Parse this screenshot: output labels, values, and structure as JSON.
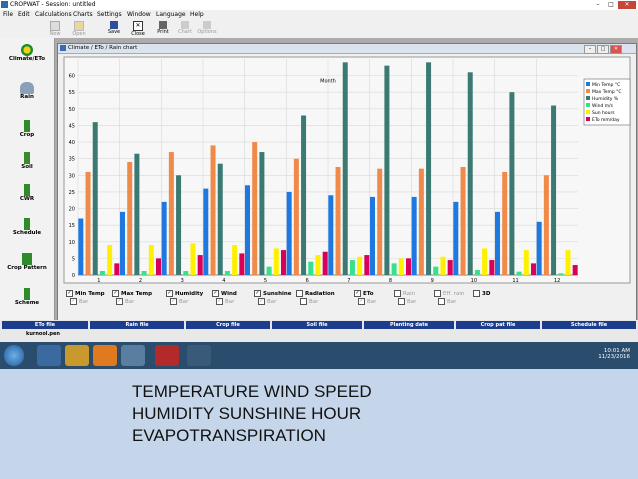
{
  "app": {
    "title": "CROPWAT - Session: untitled"
  },
  "menu": [
    "File",
    "Edit",
    "Calculations",
    "Charts",
    "Settings",
    "Window",
    "Language",
    "Help"
  ],
  "toolbar": [
    {
      "label": "New",
      "enabled": false,
      "icon": "new-file-icon"
    },
    {
      "label": "Open",
      "enabled": false,
      "icon": "open-folder-icon"
    },
    {
      "label": "Save",
      "enabled": true,
      "icon": "save-disk-icon"
    },
    {
      "label": "Close",
      "enabled": true,
      "icon": "close-icon"
    },
    {
      "label": "Print",
      "enabled": true,
      "icon": "print-icon"
    },
    {
      "label": "Chart",
      "enabled": false,
      "icon": "chart-icon"
    },
    {
      "label": "Options",
      "enabled": false,
      "icon": "options-icon"
    }
  ],
  "sidebar": [
    {
      "label": "Climate/ETo",
      "icon": "climate-icon"
    },
    {
      "label": "Rain",
      "icon": "rain-icon"
    },
    {
      "label": "Crop",
      "icon": "crop-icon"
    },
    {
      "label": "Soil",
      "icon": "soil-icon"
    },
    {
      "label": "CWR",
      "icon": "cwr-icon"
    },
    {
      "label": "Schedule",
      "icon": "schedule-icon"
    },
    {
      "label": "Crop Pattern",
      "icon": "crop-pattern-icon"
    },
    {
      "label": "Scheme",
      "icon": "scheme-icon"
    }
  ],
  "window": {
    "title": "Climate / ETo / Rain chart"
  },
  "chart_data": {
    "type": "bar",
    "title": "",
    "xlabel": "Month",
    "ylabel": "",
    "ylim": [
      0,
      65
    ],
    "yticks": [
      0,
      5,
      10,
      15,
      20,
      25,
      30,
      35,
      40,
      45,
      50,
      55,
      60
    ],
    "grid": true,
    "legend": "top-right",
    "categories": [
      "1",
      "2",
      "3",
      "4",
      "5",
      "6",
      "7",
      "8",
      "9",
      "10",
      "11",
      "12"
    ],
    "series": [
      {
        "name": "Min Temp °C",
        "color": "#1f78e0",
        "values": [
          17,
          19,
          22,
          26,
          27,
          25,
          24,
          23.5,
          23.5,
          22,
          19,
          16
        ]
      },
      {
        "name": "Max Temp °C",
        "color": "#f08a4b",
        "values": [
          31,
          34,
          37,
          39,
          40,
          35,
          32.5,
          32,
          32,
          32.5,
          31,
          30
        ]
      },
      {
        "name": "Humidity %",
        "color": "#3a7a72",
        "values": [
          46,
          36.5,
          30,
          33.5,
          37,
          48,
          64,
          63,
          64,
          61,
          55,
          51
        ]
      },
      {
        "name": "Wind m/s",
        "color": "#39e08a",
        "values": [
          1.2,
          1.2,
          1.2,
          1.2,
          2.5,
          4,
          4.5,
          3.5,
          2.5,
          1.5,
          1,
          0.5
        ]
      },
      {
        "name": "Sun hours",
        "color": "#fff000",
        "values": [
          9,
          9,
          9.5,
          9,
          8,
          6,
          5.5,
          5,
          5.5,
          8,
          7.5,
          7.5
        ]
      },
      {
        "name": "ETo mm/day",
        "color": "#d8005a",
        "values": [
          3.5,
          5,
          6,
          6.5,
          7.5,
          7,
          6,
          5,
          4.5,
          4.5,
          3.5,
          3
        ]
      }
    ]
  },
  "checks": [
    {
      "label": "Min Temp",
      "checked": true,
      "enabled": true,
      "sub": "Bar"
    },
    {
      "label": "Max Temp",
      "checked": true,
      "enabled": true,
      "sub": "Bar"
    },
    {
      "label": "Humidity",
      "checked": true,
      "enabled": true,
      "sub": "Bar"
    },
    {
      "label": "Wind",
      "checked": true,
      "enabled": true,
      "sub": "Bar"
    },
    {
      "label": "Sunshine",
      "checked": true,
      "enabled": true,
      "sub": "Bar"
    },
    {
      "label": "Radiation",
      "checked": false,
      "enabled": true,
      "sub": "Bar"
    },
    {
      "label": "ETo",
      "checked": true,
      "enabled": true,
      "sub": "Bar"
    },
    {
      "label": "Rain",
      "checked": false,
      "enabled": false,
      "sub": "Bar"
    },
    {
      "label": "Eff. rain",
      "checked": false,
      "enabled": false,
      "sub": "Bar"
    }
  ],
  "check3d": "3D",
  "filebar": {
    "headers": [
      "ETo file",
      "Rain file",
      "Crop file",
      "Soil file",
      "Planting date",
      "Crop pat file",
      "Schedule file"
    ],
    "eto_value": "kurnool.pen"
  },
  "clock": {
    "time": "10:01 AM",
    "date": "11/23/2016"
  },
  "caption": [
    "TEMPERATURE WIND SPEED",
    "HUMIDITY SUNSHINE HOUR",
    "EVAPOTRANSPIRATION"
  ]
}
